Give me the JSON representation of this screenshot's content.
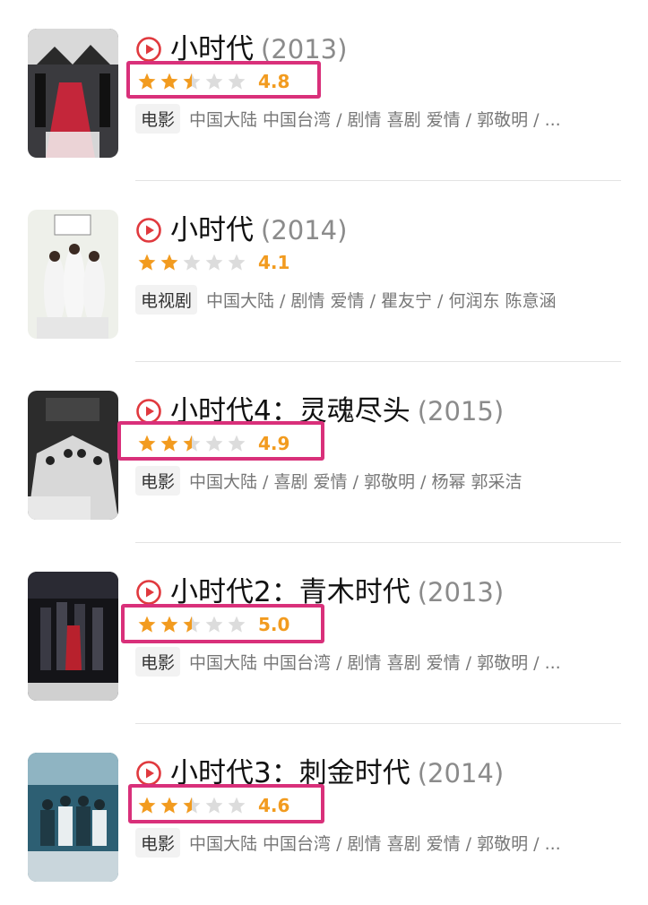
{
  "colors": {
    "star_filled": "#f29b1f",
    "star_empty": "#dcdcdc",
    "play_icon": "#e0393e",
    "highlight_box": "#d9307a"
  },
  "items": [
    {
      "title": "小时代",
      "year": "(2013)",
      "rating": "4.8",
      "stars_filled": 2.5,
      "type_tag": "电影",
      "info": "中国大陆 中国台湾 / 剧情 喜剧 爱情 / 郭敬明 / ...",
      "highlighted": true
    },
    {
      "title": "小时代",
      "year": "(2014)",
      "rating": "4.1",
      "stars_filled": 2,
      "type_tag": "电视剧",
      "info": "中国大陆 / 剧情 爱情 / 瞿友宁 / 何润东 陈意涵",
      "highlighted": false
    },
    {
      "title": "小时代4：灵魂尽头",
      "year": "(2015)",
      "rating": "4.9",
      "stars_filled": 2.5,
      "type_tag": "电影",
      "info": "中国大陆 / 喜剧 爱情 / 郭敬明 / 杨幂 郭采洁",
      "highlighted": true
    },
    {
      "title": "小时代2：青木时代",
      "year": "(2013)",
      "rating": "5.0",
      "stars_filled": 2.5,
      "type_tag": "电影",
      "info": "中国大陆 中国台湾 / 剧情 喜剧 爱情 / 郭敬明 / ...",
      "highlighted": true
    },
    {
      "title": "小时代3：刺金时代",
      "year": "(2014)",
      "rating": "4.6",
      "stars_filled": 2.5,
      "type_tag": "电影",
      "info": "中国大陆 中国台湾 / 剧情 喜剧 爱情 / 郭敬明 / ...",
      "highlighted": true
    }
  ]
}
